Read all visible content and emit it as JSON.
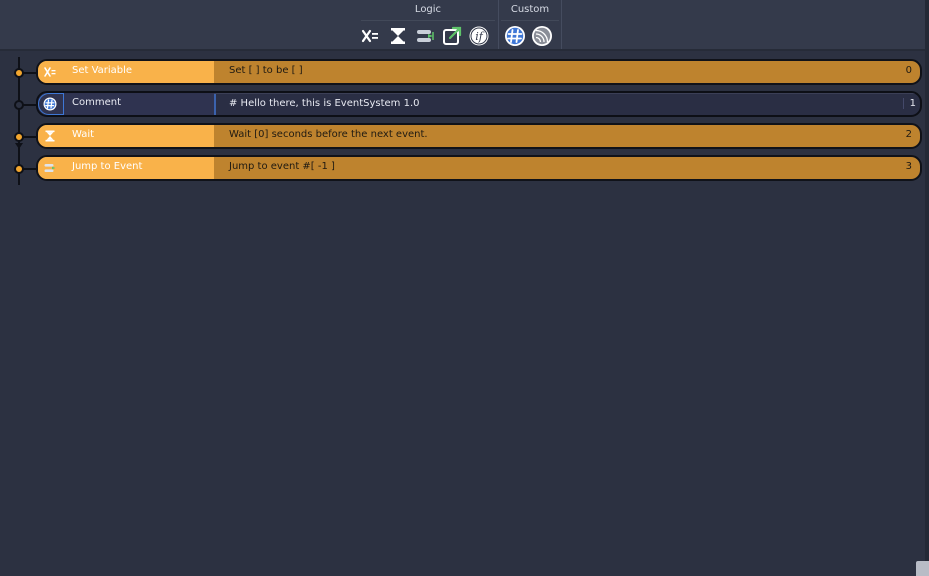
{
  "toolbar": {
    "groups": [
      {
        "title": "Logic",
        "buttons": [
          {
            "icon": "set-variable-icon"
          },
          {
            "icon": "wait-hourglass-icon"
          },
          {
            "icon": "jump-to-event-icon"
          },
          {
            "icon": "go-to-scene-icon"
          },
          {
            "icon": "condition-if-icon"
          }
        ]
      },
      {
        "title": "Custom",
        "buttons": [
          {
            "icon": "comment-hash-icon"
          },
          {
            "icon": "custom-event-icon"
          }
        ]
      }
    ]
  },
  "events": [
    {
      "name": "Set Variable",
      "description": "Set [ ] to be [ ]",
      "index": "0",
      "icon": "set-variable-icon",
      "style": "orange"
    },
    {
      "name": "Comment",
      "description": "# Hello there, this is EventSystem 1.0",
      "index": "1",
      "icon": "comment-hash-icon",
      "style": "comment"
    },
    {
      "name": "Wait",
      "description": "Wait [0] seconds before the next event.",
      "index": "2",
      "icon": "wait-hourglass-icon",
      "style": "orange"
    },
    {
      "name": "Jump to Event",
      "description": "Jump to event #[ -1 ]",
      "index": "3",
      "icon": "jump-to-event-icon",
      "style": "orange"
    }
  ],
  "colors": {
    "background": "#2c3141",
    "event_head": "#f9b24a",
    "event_body": "#be832e",
    "comment_body": "#2a2e44",
    "selection": "#3e77d6"
  }
}
